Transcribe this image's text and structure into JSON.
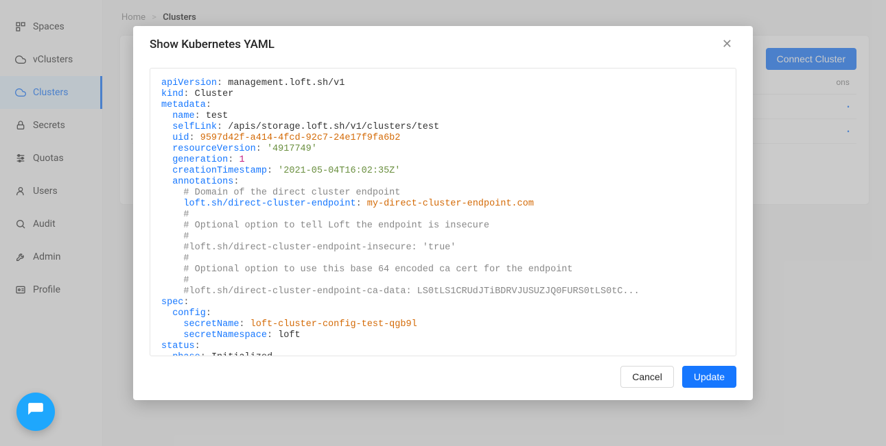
{
  "sidebar": {
    "items": [
      {
        "label": "Spaces"
      },
      {
        "label": "vClusters"
      },
      {
        "label": "Clusters"
      },
      {
        "label": "Secrets"
      },
      {
        "label": "Quotas"
      },
      {
        "label": "Users"
      },
      {
        "label": "Audit"
      },
      {
        "label": "Admin"
      },
      {
        "label": "Profile"
      }
    ]
  },
  "breadcrumb": {
    "home": "Home",
    "sep": ">",
    "current": "Clusters"
  },
  "header": {
    "connect_label": "Connect Cluster",
    "actions_hint": "ons"
  },
  "modal": {
    "title": "Show Kubernetes YAML",
    "close": "✕",
    "cancel_label": "Cancel",
    "update_label": "Update",
    "yaml": {
      "apiVersion_key": "apiVersion",
      "apiVersion_val": "management.loft.sh/v1",
      "kind_key": "kind",
      "kind_val": "Cluster",
      "metadata_key": "metadata",
      "name_key": "name",
      "name_val": "test",
      "selfLink_key": "selfLink",
      "selfLink_val": "/apis/storage.loft.sh/v1/clusters/test",
      "uid_key": "uid",
      "uid_val": "9597d42f-a414-4fcd-92c7-24e17f9fa6b2",
      "resourceVersion_key": "resourceVersion",
      "resourceVersion_val": "'4917749'",
      "generation_key": "generation",
      "generation_val": "1",
      "creationTimestamp_key": "creationTimestamp",
      "creationTimestamp_val": "'2021-05-04T16:02:35Z'",
      "annotations_key": "annotations",
      "c1": "# Domain of the direct cluster endpoint",
      "anno1_key": "loft.sh/direct-cluster-endpoint",
      "anno1_val": "my-direct-cluster-endpoint.com",
      "c_blank": "#",
      "c2": "# Optional option to tell Loft the endpoint is insecure",
      "c3": "#loft.sh/direct-cluster-endpoint-insecure: 'true'",
      "c4": "# Optional option to use this base 64 encoded ca cert for the endpoint",
      "c5": "#loft.sh/direct-cluster-endpoint-ca-data: LS0tLS1CRUdJTiBDRVJUSUZJQ0FURS0tLS0tC...",
      "spec_key": "spec",
      "config_key": "config",
      "secretName_key": "secretName",
      "secretName_val": "loft-cluster-config-test-qgb9l",
      "secretNamespace_key": "secretNamespace",
      "secretNamespace_val": "loft",
      "status_key": "status",
      "phase_key": "phase",
      "phase_val": "Initialized"
    }
  }
}
